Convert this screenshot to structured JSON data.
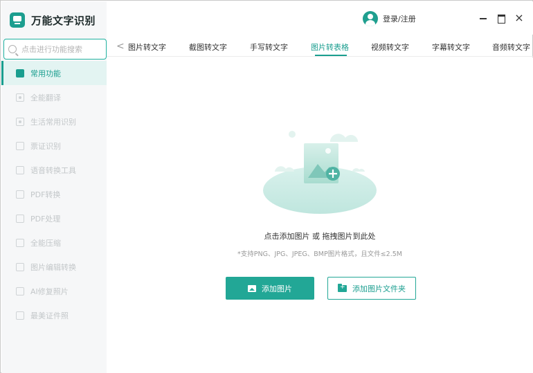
{
  "app": {
    "title": "万能文字识别"
  },
  "search": {
    "placeholder": "点击进行功能搜索"
  },
  "sidebar": {
    "items": [
      {
        "label": "常用功能",
        "active": true
      },
      {
        "label": "全能翻译"
      },
      {
        "label": "生活常用识别"
      },
      {
        "label": "票证识别"
      },
      {
        "label": "语音转换工具"
      },
      {
        "label": "PDF转换"
      },
      {
        "label": "PDF处理"
      },
      {
        "label": "全能压缩"
      },
      {
        "label": "图片编辑转换"
      },
      {
        "label": "AI修复照片"
      },
      {
        "label": "最美证件照"
      }
    ]
  },
  "header": {
    "user_label": "登录/注册",
    "minimize": "—",
    "maximize": "□",
    "close": "×"
  },
  "tabs": {
    "back": "<",
    "items": [
      {
        "label": "图片转文字"
      },
      {
        "label": "截图转文字"
      },
      {
        "label": "手写转文字"
      },
      {
        "label": "图片转表格",
        "active": true
      },
      {
        "label": "视频转文字"
      },
      {
        "label": "字幕转文字"
      },
      {
        "label": "音频转文字"
      }
    ]
  },
  "main": {
    "hint": "点击添加图片 或 拖拽图片到此处",
    "subhint": "*支持PNG、JPG、JPEG、BMP图片格式，且文件≤2.5M",
    "add_image": "添加图片",
    "add_folder": "添加图片文件夹"
  },
  "colors": {
    "accent": "#1a9e8f",
    "button": "#22a796",
    "sidebar_bg": "#f6f7f8",
    "active_bg": "#e3f4f2"
  }
}
